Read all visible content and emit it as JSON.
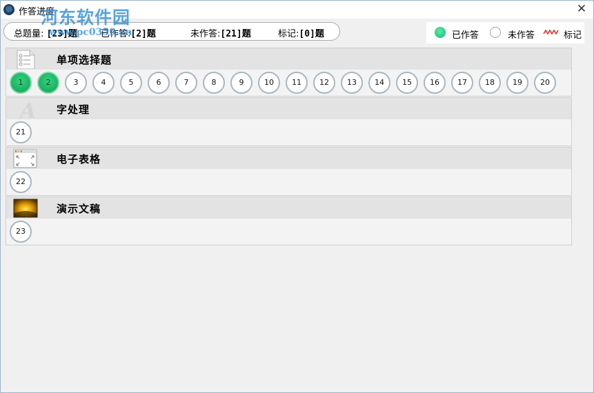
{
  "window": {
    "title": "作答进度",
    "close_glyph": "✕"
  },
  "watermark": {
    "line1": "河东软件园",
    "line2": "www.pc0359.cn"
  },
  "summary": {
    "total_label": "总题量:",
    "total_value": "[23]题",
    "answered_label": "已作答:",
    "answered_value": "[2]题",
    "unanswered_label": "未作答:",
    "unanswered_value": "[21]题",
    "marked_label": "标记:",
    "marked_value": "[0]题"
  },
  "legend": {
    "answered": "已作答",
    "unanswered": "未作答",
    "marked": "标记"
  },
  "colors": {
    "answered": "#1fbf6a",
    "unanswered_border": "#a9b6bd",
    "mark_wave": "#e03030"
  },
  "sections": [
    {
      "title": "单项选择题",
      "icon": "list-document-icon",
      "questions": [
        {
          "n": "1",
          "done": true
        },
        {
          "n": "2",
          "done": true
        },
        {
          "n": "3",
          "done": false
        },
        {
          "n": "4",
          "done": false
        },
        {
          "n": "5",
          "done": false
        },
        {
          "n": "6",
          "done": false
        },
        {
          "n": "7",
          "done": false
        },
        {
          "n": "8",
          "done": false
        },
        {
          "n": "9",
          "done": false
        },
        {
          "n": "10",
          "done": false
        },
        {
          "n": "11",
          "done": false
        },
        {
          "n": "12",
          "done": false
        },
        {
          "n": "13",
          "done": false
        },
        {
          "n": "14",
          "done": false
        },
        {
          "n": "15",
          "done": false
        },
        {
          "n": "16",
          "done": false
        },
        {
          "n": "17",
          "done": false
        },
        {
          "n": "18",
          "done": false
        },
        {
          "n": "19",
          "done": false
        },
        {
          "n": "20",
          "done": false
        }
      ]
    },
    {
      "title": "字处理",
      "icon": "word-processor-a-icon",
      "questions": [
        {
          "n": "21",
          "done": false
        }
      ]
    },
    {
      "title": "电子表格",
      "icon": "spreadsheet-window-icon",
      "questions": [
        {
          "n": "22",
          "done": false
        }
      ]
    },
    {
      "title": "演示文稿",
      "icon": "presentation-slide-icon",
      "questions": [
        {
          "n": "23",
          "done": false
        }
      ]
    }
  ]
}
